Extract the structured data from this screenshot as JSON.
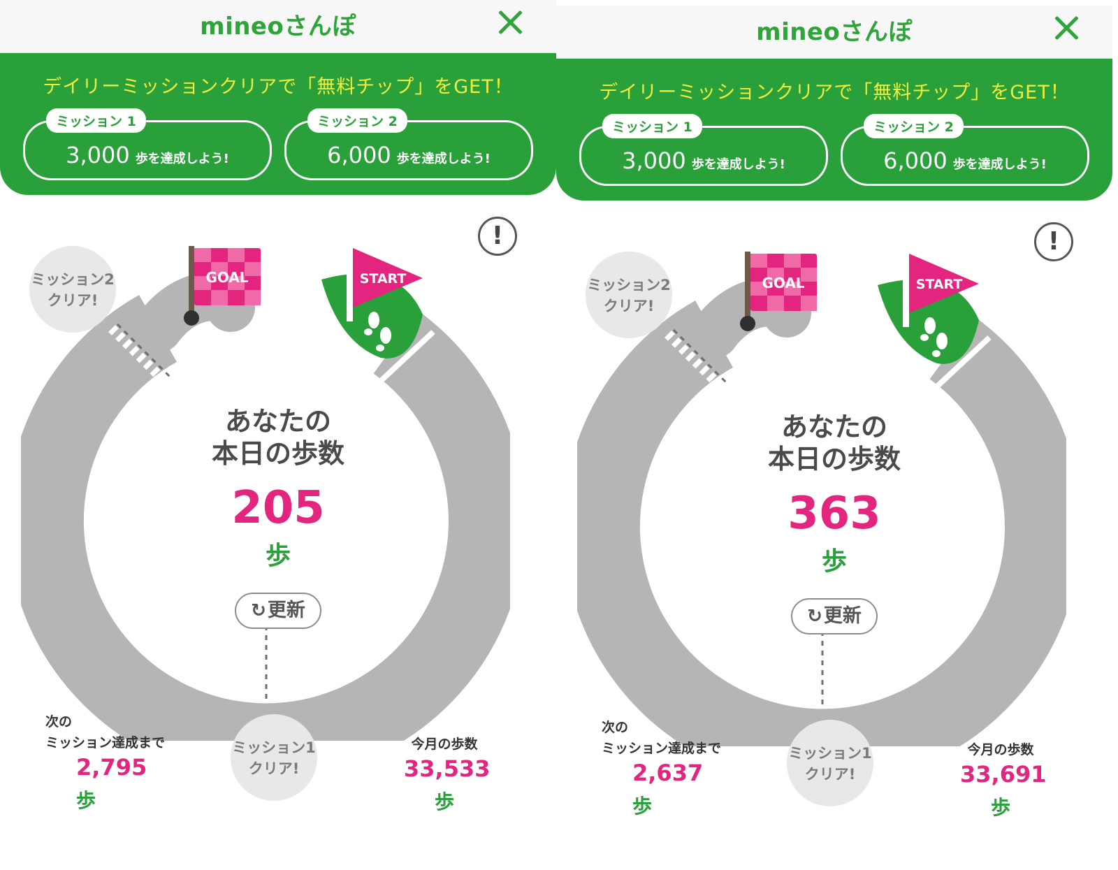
{
  "screens": [
    {
      "app_title": "mineoさんぽ",
      "banner_headline": "デイリーミッションクリアで「無料チップ」をGET！",
      "missions": [
        {
          "tag": "ミッション 1",
          "value": "3,000",
          "suffix": "歩を達成しよう!"
        },
        {
          "tag": "ミッション 2",
          "value": "6,000",
          "suffix": "歩を達成しよう!"
        }
      ],
      "info_icon": "!",
      "goal_flag": "GOAL",
      "start_flag": "START",
      "mission2_bubble": [
        "ミッション2",
        "クリア!"
      ],
      "mission1_bubble": [
        "ミッション1",
        "クリア!"
      ],
      "center_label": [
        "あなたの",
        "本日の歩数"
      ],
      "today_steps": "205",
      "unit": "歩",
      "refresh_label": "更新",
      "next_label": [
        "次の",
        "ミッション達成まで"
      ],
      "next_steps": "2,795",
      "month_label": "今月の歩数",
      "month_steps": "33,533"
    },
    {
      "app_title": "mineoさんぽ",
      "banner_headline": "デイリーミッションクリアで「無料チップ」をGET！",
      "missions": [
        {
          "tag": "ミッション 1",
          "value": "3,000",
          "suffix": "歩を達成しよう!"
        },
        {
          "tag": "ミッション 2",
          "value": "6,000",
          "suffix": "歩を達成しよう!"
        }
      ],
      "info_icon": "!",
      "goal_flag": "GOAL",
      "start_flag": "START",
      "mission2_bubble": [
        "ミッション2",
        "クリア!"
      ],
      "mission1_bubble": [
        "ミッション1",
        "クリア!"
      ],
      "center_label": [
        "あなたの",
        "本日の歩数"
      ],
      "today_steps": "363",
      "unit": "歩",
      "refresh_label": "更新",
      "next_label": [
        "次の",
        "ミッション達成まで"
      ],
      "next_steps": "2,637",
      "month_label": "今月の歩数",
      "month_steps": "33,691"
    }
  ],
  "colors": {
    "brand_green": "#2aa03a",
    "headline_yellow": "#f3ee3c",
    "accent_pink": "#e3257f",
    "track_gray": "#b5b5b5"
  },
  "icons": {
    "close": "close-icon",
    "info": "info-icon",
    "refresh": "refresh-icon",
    "footsteps": "footsteps-icon"
  }
}
